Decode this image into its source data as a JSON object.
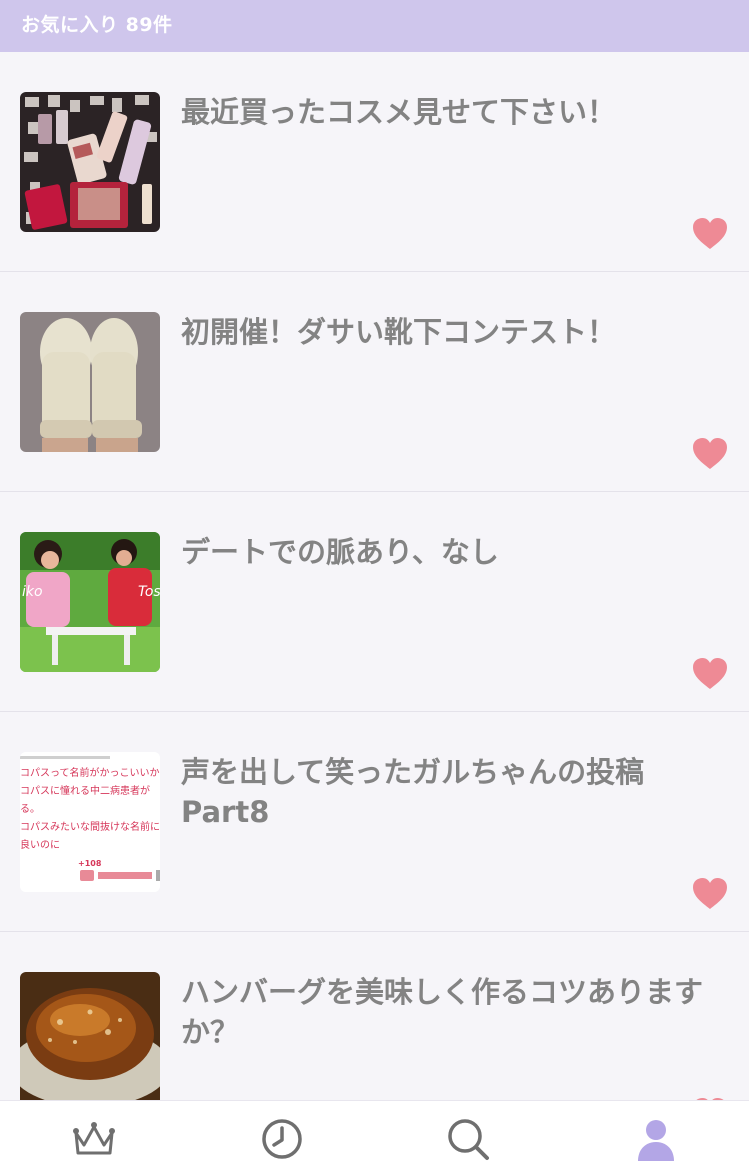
{
  "header": {
    "title": "お気に入り 89件"
  },
  "items": [
    {
      "title": "最近買ったコスメ見せて下さい！"
    },
    {
      "title": "初開催！ダサい靴下コンテスト！"
    },
    {
      "title": "デートでの脈あり、なし"
    },
    {
      "title": "声を出して笑ったガルちゃんの投稿Part8"
    },
    {
      "title": "ハンバーグを美味しく作るコツありますか？"
    }
  ],
  "thumb4": {
    "lines": [
      "コパスって名前がかっこいいか",
      "コパスに憧れる中二病患者が",
      "る。",
      "コパスみたいな間抜けな名前に",
      "良いのに"
    ],
    "score": "+108"
  },
  "thumb3": {
    "left_text": "iko",
    "right_text": "Tos"
  },
  "colors": {
    "header": "#cfc6ec",
    "heart": "#ee8a95",
    "accent": "#b3a6e6"
  },
  "tabs": [
    {
      "icon": "crown-icon"
    },
    {
      "icon": "clock-icon"
    },
    {
      "icon": "search-icon"
    },
    {
      "icon": "person-icon",
      "active": true
    }
  ]
}
